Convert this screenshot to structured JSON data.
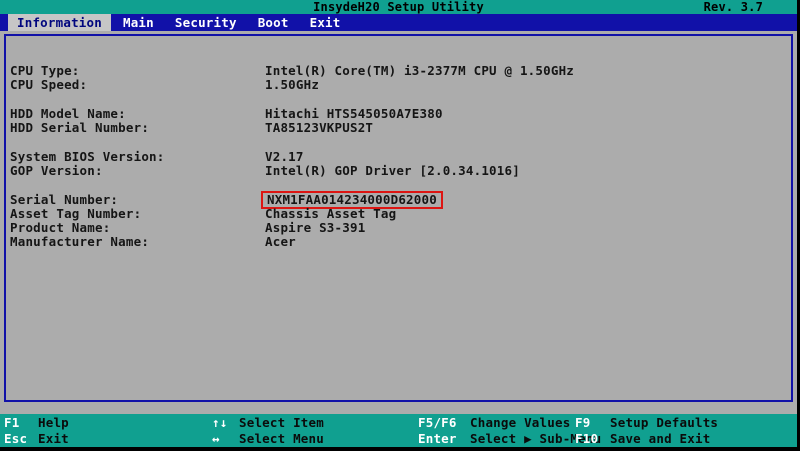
{
  "title_bar": {
    "title": "InsydeH20 Setup Utility",
    "revision": "Rev. 3.7"
  },
  "menu": {
    "selected": "Information",
    "items": [
      {
        "label": "Information"
      },
      {
        "label": "Main"
      },
      {
        "label": "Security"
      },
      {
        "label": "Boot"
      },
      {
        "label": "Exit"
      }
    ]
  },
  "info": {
    "groups": [
      {
        "rows": [
          {
            "label": "CPU Type:",
            "value": "Intel(R) Core(TM) i3-2377M CPU @ 1.50GHz"
          },
          {
            "label": "CPU Speed:",
            "value": "1.50GHz"
          }
        ]
      },
      {
        "rows": [
          {
            "label": "HDD Model Name:",
            "value": "Hitachi HTS545050A7E380"
          },
          {
            "label": "HDD Serial Number:",
            "value": "TA85123VKPUS2T"
          }
        ]
      },
      {
        "rows": [
          {
            "label": "System BIOS Version:",
            "value": "V2.17"
          },
          {
            "label": "GOP Version:",
            "value": "Intel(R) GOP Driver [2.0.34.1016]"
          }
        ]
      },
      {
        "rows": [
          {
            "label": "Serial Number:",
            "value": "NXM1FAA014234000D62000",
            "highlighted": true
          },
          {
            "label": "Asset Tag Number:",
            "value": "Chassis Asset Tag"
          },
          {
            "label": "Product Name:",
            "value": "Aspire S3-391"
          },
          {
            "label": "Manufacturer Name:",
            "value": "Acer"
          }
        ]
      }
    ]
  },
  "help_bar": {
    "items": [
      {
        "key": "F1",
        "label": "Help"
      },
      {
        "key": "↑↓",
        "label": "Select Item"
      },
      {
        "key": "F5/F6",
        "label": "Change Values"
      },
      {
        "key": "F9",
        "label": "Setup Defaults"
      },
      {
        "key": "Esc",
        "label": "Exit"
      },
      {
        "key": "↔",
        "label": "Select Menu"
      },
      {
        "key": "Enter",
        "label": "Select ▶ Sub-Menu"
      },
      {
        "key": "F10",
        "label": "Save and Exit"
      }
    ]
  },
  "colors": {
    "teal": "#10A090",
    "menu_blue": "#1111A8",
    "content_gray": "#ACACAC",
    "highlight_red": "#DD1512",
    "selected_tab_bg": "#C6C6C6",
    "selected_tab_text": "#00067E"
  }
}
